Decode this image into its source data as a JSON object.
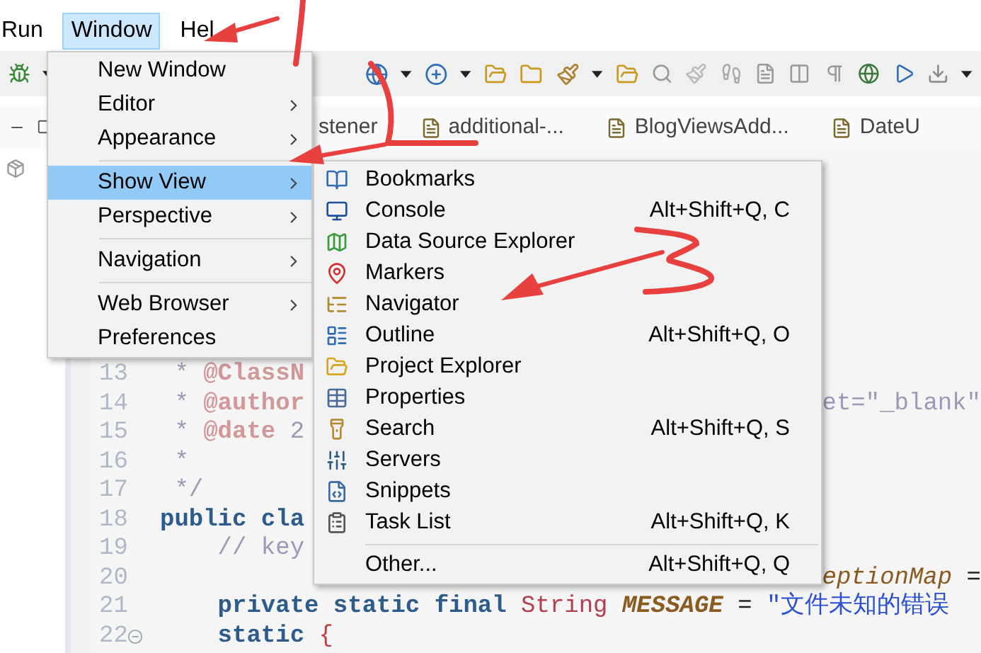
{
  "menu_bar": [
    {
      "label": "Run",
      "selected": false
    },
    {
      "label": "Window",
      "selected": true
    },
    {
      "label": "Hel",
      "selected": false
    }
  ],
  "tabs": [
    {
      "kind": "cut",
      "label": "stener"
    },
    {
      "kind": "file",
      "label": "additional-..."
    },
    {
      "kind": "file",
      "label": "BlogViewsAdd..."
    },
    {
      "kind": "file",
      "label": "DateU"
    }
  ],
  "editor": {
    "lines": [
      {
        "number": "13",
        "collapsible": false,
        "left": [
          {
            "kind": "comment",
            "text": " * "
          },
          {
            "kind": "tag",
            "text": "@ClassN"
          }
        ]
      },
      {
        "number": "14",
        "collapsible": false,
        "left": [
          {
            "kind": "comment",
            "text": " * "
          },
          {
            "kind": "tag",
            "text": "@author"
          }
        ],
        "right": [
          {
            "kind": "comment",
            "text": "et=\"_blank\""
          }
        ]
      },
      {
        "number": "15",
        "collapsible": false,
        "left": [
          {
            "kind": "comment",
            "text": " * "
          },
          {
            "kind": "tag",
            "text": "@date"
          },
          {
            "kind": "comment",
            "text": " 2"
          }
        ]
      },
      {
        "number": "16",
        "collapsible": false,
        "left": [
          {
            "kind": "comment",
            "text": " *"
          }
        ]
      },
      {
        "number": "17",
        "collapsible": false,
        "left": [
          {
            "kind": "comment",
            "text": " */"
          }
        ]
      },
      {
        "number": "18",
        "collapsible": false,
        "left": [
          {
            "kind": "keyword",
            "text": "public cla"
          }
        ]
      },
      {
        "number": "19",
        "collapsible": false,
        "left": [
          {
            "kind": "comment",
            "text": "    // key"
          }
        ]
      },
      {
        "number": "20",
        "collapsible": false,
        "right": [
          {
            "kind": "field",
            "text": "eptionMap"
          },
          {
            "kind": "plain",
            "text": " ="
          }
        ]
      },
      {
        "number": "21",
        "collapsible": false,
        "left": [
          {
            "kind": "keyword",
            "text": "    private static final "
          },
          {
            "kind": "type",
            "text": "String "
          },
          {
            "kind": "constant",
            "text": "MESSAGE"
          },
          {
            "kind": "plain",
            "text": " = "
          },
          {
            "kind": "string",
            "text": "\"文件未知的错误"
          }
        ]
      },
      {
        "number": "22",
        "collapsible": true,
        "left": [
          {
            "kind": "keyword",
            "text": "    static "
          },
          {
            "kind": "brace",
            "text": "{"
          }
        ]
      }
    ]
  },
  "window_menu": [
    {
      "kind": "item",
      "label": "New Window",
      "submenu": false,
      "selected": false
    },
    {
      "kind": "item",
      "label": "Editor",
      "submenu": true,
      "selected": false
    },
    {
      "kind": "item",
      "label": "Appearance",
      "submenu": true,
      "selected": false
    },
    {
      "kind": "separator"
    },
    {
      "kind": "item",
      "label": "Show View",
      "submenu": true,
      "selected": true
    },
    {
      "kind": "item",
      "label": "Perspective",
      "submenu": true,
      "selected": false
    },
    {
      "kind": "separator"
    },
    {
      "kind": "item",
      "label": "Navigation",
      "submenu": true,
      "selected": false
    },
    {
      "kind": "separator"
    },
    {
      "kind": "item",
      "label": "Web Browser",
      "submenu": true,
      "selected": false
    },
    {
      "kind": "item",
      "label": "Preferences",
      "submenu": false,
      "selected": false
    }
  ],
  "show_view_menu": [
    {
      "kind": "item",
      "label": "Bookmarks",
      "selected": false
    },
    {
      "kind": "item",
      "label": "Console",
      "shortcut": "Alt+Shift+Q, C",
      "selected": false
    },
    {
      "kind": "item",
      "label": "Data Source Explorer",
      "selected": false
    },
    {
      "kind": "item",
      "label": "Markers",
      "selected": false
    },
    {
      "kind": "item",
      "label": "Navigator",
      "selected": false
    },
    {
      "kind": "item",
      "label": "Outline",
      "shortcut": "Alt+Shift+Q, O",
      "selected": false
    },
    {
      "kind": "item",
      "label": "Project Explorer",
      "selected": false
    },
    {
      "kind": "item",
      "label": "Properties",
      "selected": false
    },
    {
      "kind": "item",
      "label": "Search",
      "shortcut": "Alt+Shift+Q, S",
      "selected": false
    },
    {
      "kind": "item",
      "label": "Servers",
      "selected": false
    },
    {
      "kind": "item",
      "label": "Snippets",
      "selected": false
    },
    {
      "kind": "item",
      "label": "Task List",
      "shortcut": "Alt+Shift+Q, K",
      "selected": false
    },
    {
      "kind": "separator"
    },
    {
      "kind": "item",
      "label": "Other...",
      "shortcut": "Alt+Shift+Q, Q",
      "selected": false
    }
  ]
}
